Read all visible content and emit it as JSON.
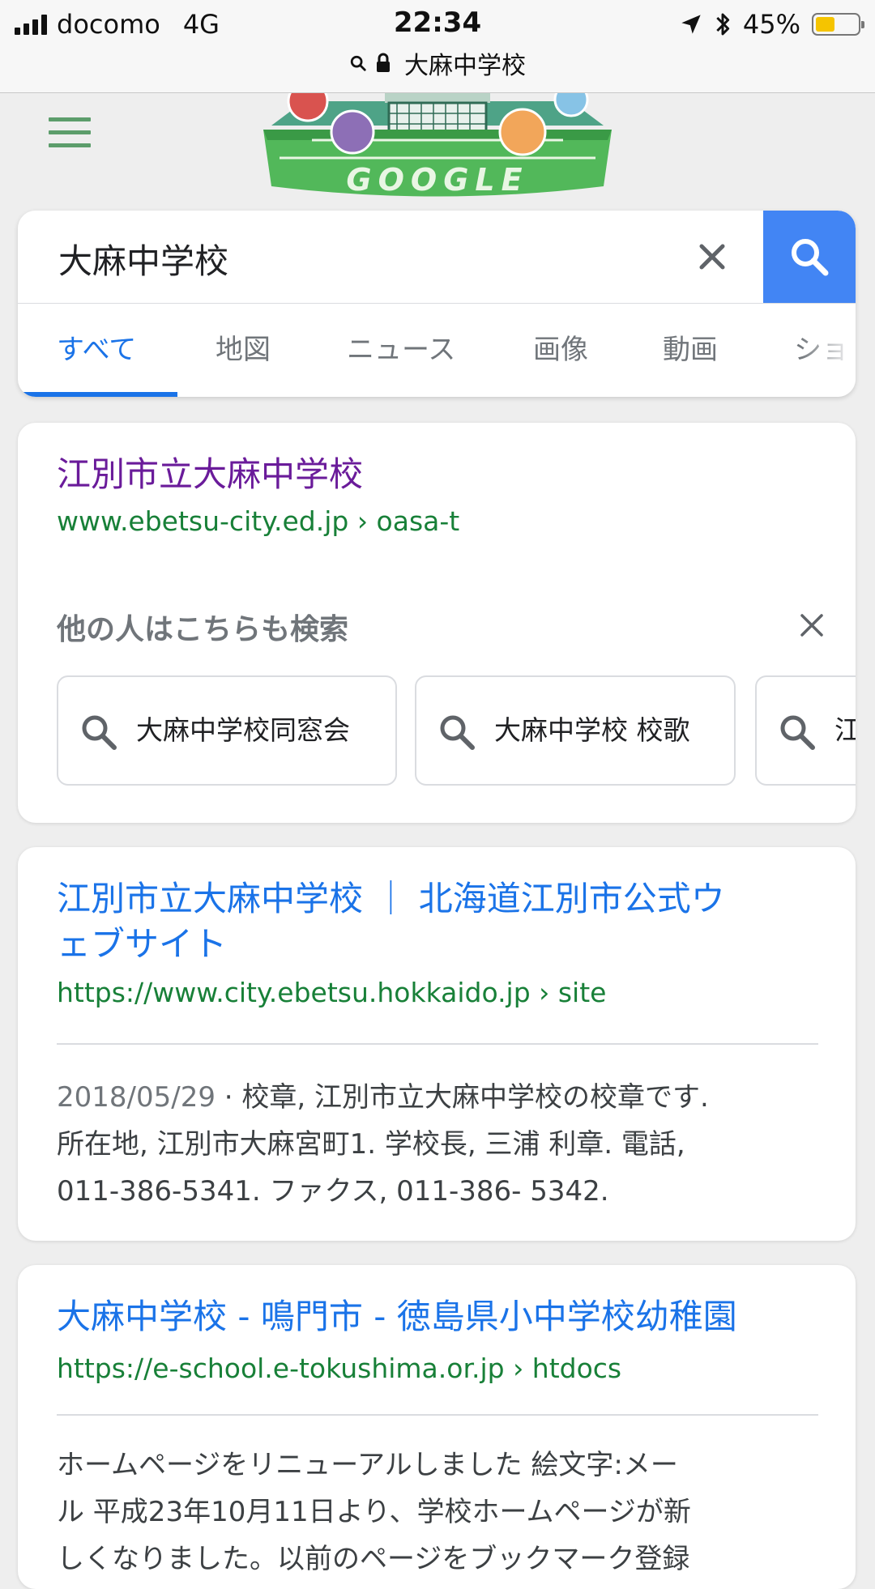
{
  "status_bar": {
    "carrier": "docomo",
    "network": "4G",
    "time": "22:34",
    "battery_percent": "45%",
    "battery_level": 0.45,
    "battery_color": "#f5c400",
    "url_title": "大麻中学校"
  },
  "header": {
    "menu_icon": "hamburger-icon",
    "logo_alt": "Google Doodle (football)",
    "logo_text": "GOOGLE"
  },
  "search": {
    "query": "大麻中学校",
    "clear_icon": "close-icon",
    "submit_icon": "search-icon",
    "button_color": "#4285f4"
  },
  "tabs": [
    {
      "label": "すべて",
      "active": true
    },
    {
      "label": "地図"
    },
    {
      "label": "ニュース"
    },
    {
      "label": "画像"
    },
    {
      "label": "動画"
    },
    {
      "label": "ショ"
    }
  ],
  "results": [
    {
      "title": "江別市立大麻中学校",
      "url": "www.ebetsu-city.ed.jp › oasa-t",
      "visited": true,
      "related": {
        "heading": "他の人はこちらも検索",
        "chips": [
          "大麻中学校同窓会",
          "大麻中学校 校歌",
          "江"
        ]
      }
    },
    {
      "title_line1": "江別市立大麻中学校 ｜ 北海道江別市公式ウ",
      "title_line2": "ェブサイト",
      "url": "https://www.city.ebetsu.hokkaido.jp › site",
      "date": "2018/05/29",
      "snippet_line1": "· 校章, 江別市立大麻中学校の校章です.",
      "snippet_line2": "所在地, 江別市大麻宮町1. 学校長, 三浦 利章. 電話,",
      "snippet_line3": "011-386-5341. ファクス, 011-386- 5342."
    },
    {
      "title": "大麻中学校 - 鳴門市 - 徳島県小中学校幼稚園",
      "url": "https://e-school.e-tokushima.or.jp › htdocs",
      "snippet_line1": "ホームページをリニューアルしました 絵文字:メー",
      "snippet_line2": "ル 平成23年10月11日より、学校ホームページが新",
      "snippet_line3": "しくなりました。以前のページをブックマーク登録"
    }
  ],
  "colors": {
    "link": "#1a73e8",
    "visited_link": "#6a1b9a",
    "url_green": "#188038",
    "menu_green": "#5c9d6b"
  }
}
